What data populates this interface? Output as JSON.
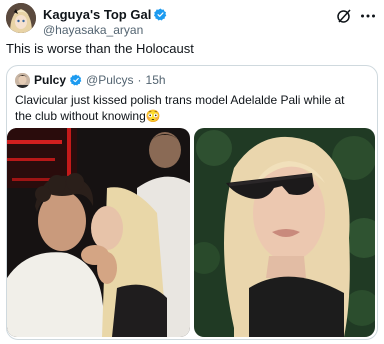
{
  "tweet": {
    "display_name": "Kaguya's Top Gal",
    "handle": "@hayasaka_aryan",
    "text": "This is worse than the Holocaust"
  },
  "quoted": {
    "display_name": "Pulcy",
    "handle": "@Pulcys",
    "separator": "·",
    "time": "15h",
    "text": "Clavicular just kissed polish trans model Adelalde Pali while at the club without knowing😳"
  },
  "icons": {
    "verified": "verified-badge-icon",
    "grok": "grok-icon",
    "more": "more-options-icon"
  },
  "colors": {
    "verified": "#1d9bf0",
    "secondary_text": "#536471",
    "border": "#cfd9de"
  }
}
